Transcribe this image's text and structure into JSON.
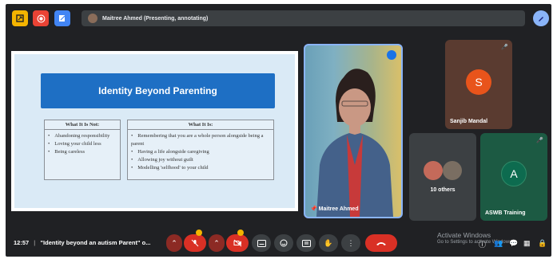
{
  "presenter_bar": {
    "text": "Maitree Ahmed (Presenting, annotating)"
  },
  "slide": {
    "title": "Identity Beyond Parenting",
    "col1": {
      "heading": "What It Is Not:",
      "items": [
        "Abandoning responsibility",
        "Loving your child less",
        "Being careless"
      ]
    },
    "col2": {
      "heading": "What It Is:",
      "items": [
        "Remembering that you are a whole person alongside being a parent",
        "Having a life alongside caregiving",
        "Allowing joy without guilt",
        "Modelling 'selfhood' to your child"
      ]
    }
  },
  "tiles": {
    "maitree": {
      "name": "Maitree Ahmed"
    },
    "sanjib": {
      "name": "Sanjib Mandal",
      "initial": "S",
      "color": "#e8541b"
    },
    "others": {
      "label": "10 others"
    },
    "aswb": {
      "name": "ASWB Training",
      "initial": "A",
      "color": "#0d6b4f"
    }
  },
  "bottom": {
    "time": "12:57",
    "meeting": "\"Identity beyond an autism Parent\" o...",
    "activate_title": "Activate Windows",
    "activate_sub": "Go to Settings to activate Windows."
  },
  "colors": {
    "accent_red": "#d93025",
    "dark_button": "#3c4043",
    "background": "#202124"
  }
}
